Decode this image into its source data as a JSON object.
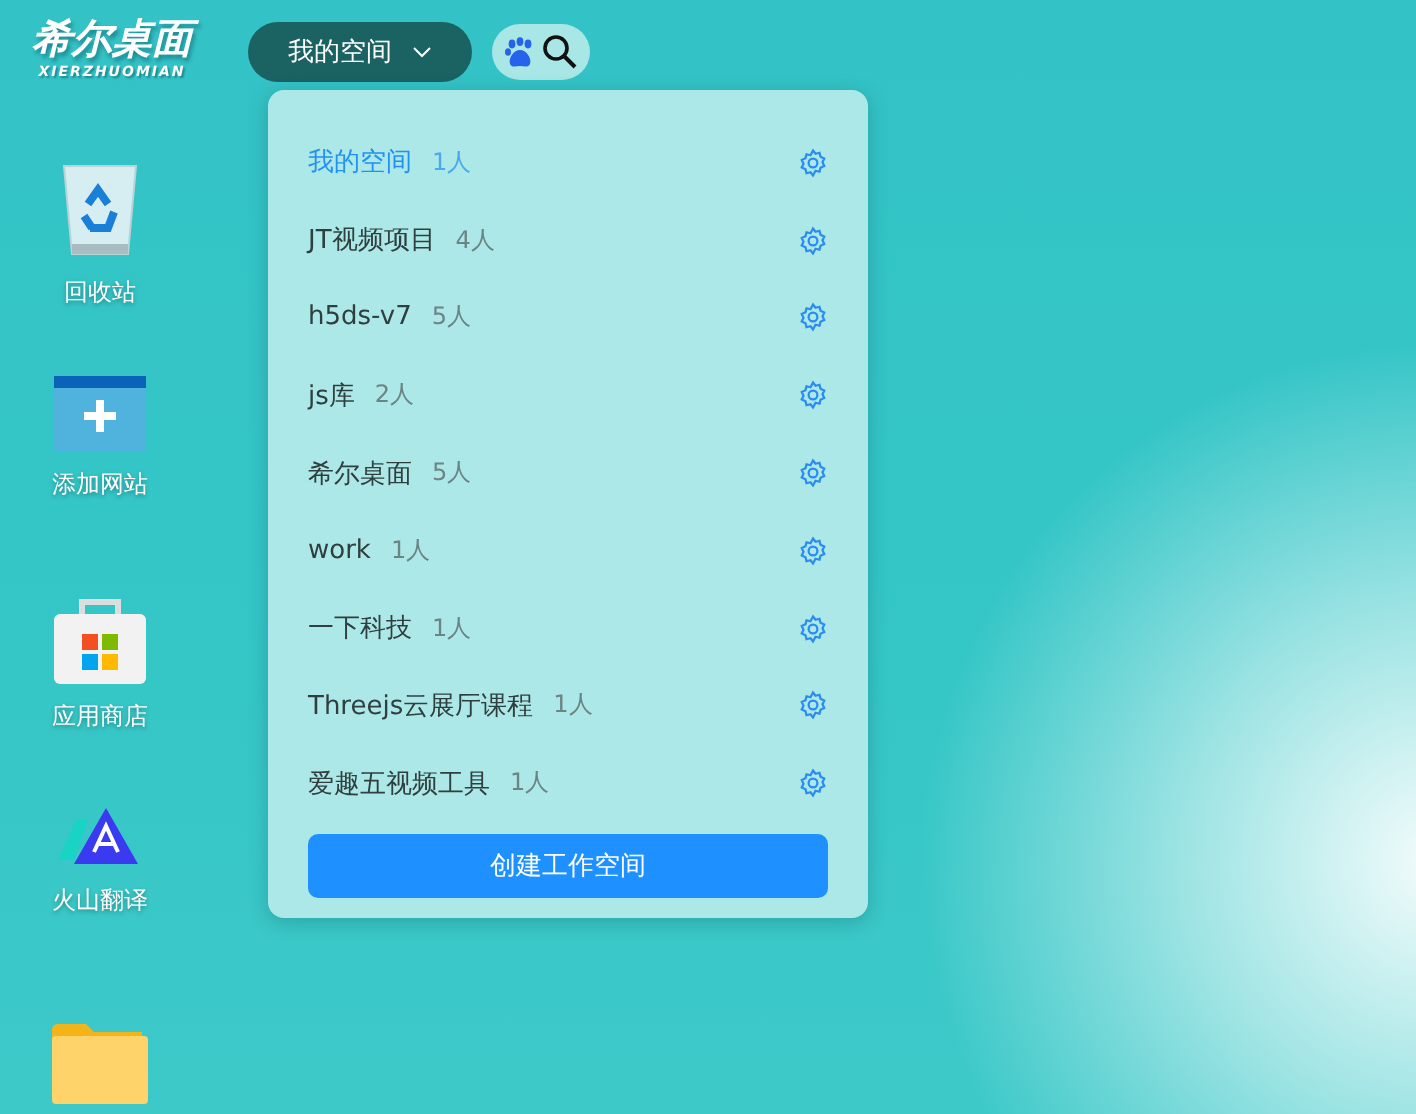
{
  "logo": {
    "title": "希尔桌面",
    "subtitle": "XIERZHUOMIAN"
  },
  "space_switcher": {
    "label": "我的空间",
    "expanded": true
  },
  "desktop_icons": [
    {
      "kind": "recycle",
      "label": "回收站"
    },
    {
      "kind": "add",
      "label": "添加网站"
    },
    {
      "kind": "store",
      "label": "应用商店"
    },
    {
      "kind": "translate",
      "label": "火山翻译"
    },
    {
      "kind": "folder"
    }
  ],
  "space_menu": {
    "items": [
      {
        "name": "我的空间",
        "members": "1人",
        "selected": true
      },
      {
        "name": "JT视频项目",
        "members": "4人",
        "selected": false
      },
      {
        "name": "h5ds-v7",
        "members": "5人",
        "selected": false
      },
      {
        "name": "js库",
        "members": "2人",
        "selected": false
      },
      {
        "name": "希尔桌面",
        "members": "5人",
        "selected": false
      },
      {
        "name": "work",
        "members": "1人",
        "selected": false
      },
      {
        "name": "一下科技",
        "members": "1人",
        "selected": false
      },
      {
        "name": "Threejs云展厅课程",
        "members": "1人",
        "selected": false
      },
      {
        "name": "爱趣五视频工具",
        "members": "1人",
        "selected": false
      }
    ],
    "create_button": "创建工作空间"
  }
}
